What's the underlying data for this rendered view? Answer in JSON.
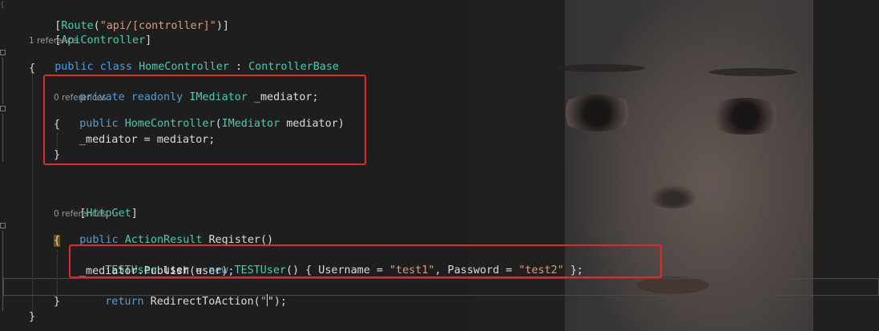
{
  "code_lines": {
    "l1": {
      "t1": "[",
      "t2": "Route",
      "t3": "(",
      "t4": "\"api/[controller]\"",
      "t5": ")]"
    },
    "l2": {
      "t1": "[",
      "t2": "ApiController",
      "t3": "]"
    },
    "l3_lens": "1 reference",
    "l4": {
      "t1": "public",
      "t2": "class",
      "t3": "HomeController",
      "t4": " : ",
      "t5": "ControllerBase"
    },
    "l5": "{",
    "l6": {
      "t1": "private",
      "t2": "readonly",
      "t3": "IMediator",
      "t4": " _mediator;"
    },
    "l7_lens": "0 references",
    "l8": {
      "t1": "public",
      "t2": "HomeController",
      "t3": "(",
      "t4": "IMediator",
      "t5": " mediator)"
    },
    "l9": "{",
    "l10": "_mediator = mediator;",
    "l11": "}",
    "l12": {
      "t1": "[",
      "t2": "HttpGet",
      "t3": "]"
    },
    "l13_lens": "0 references",
    "l14": {
      "t1": "public",
      "t2": "ActionResult",
      "t3": " Register()"
    },
    "l15": "{",
    "l16": {
      "t1": "TESTUser",
      "t2": " user = ",
      "t3": "new",
      "t4": "TESTUser",
      "t5": "() { Username = ",
      "t6": "\"test1\"",
      "t7": ", Password = ",
      "t8": "\"test2\"",
      "t9": " };"
    },
    "l17": "_mediator.Publish(user);",
    "l18": {
      "t1": "return",
      "t2": " RedirectToAction(",
      "t3": "\"",
      "t4": "\");"
    },
    "l19": "}",
    "l20": "}"
  },
  "colors": {
    "keyword": "#569cd6",
    "type": "#4ec9b0",
    "string": "#d69d85",
    "text": "#dcdcdc",
    "codelens": "#999999",
    "highlight_box": "#e02a2a",
    "background": "#1e1e1e"
  }
}
